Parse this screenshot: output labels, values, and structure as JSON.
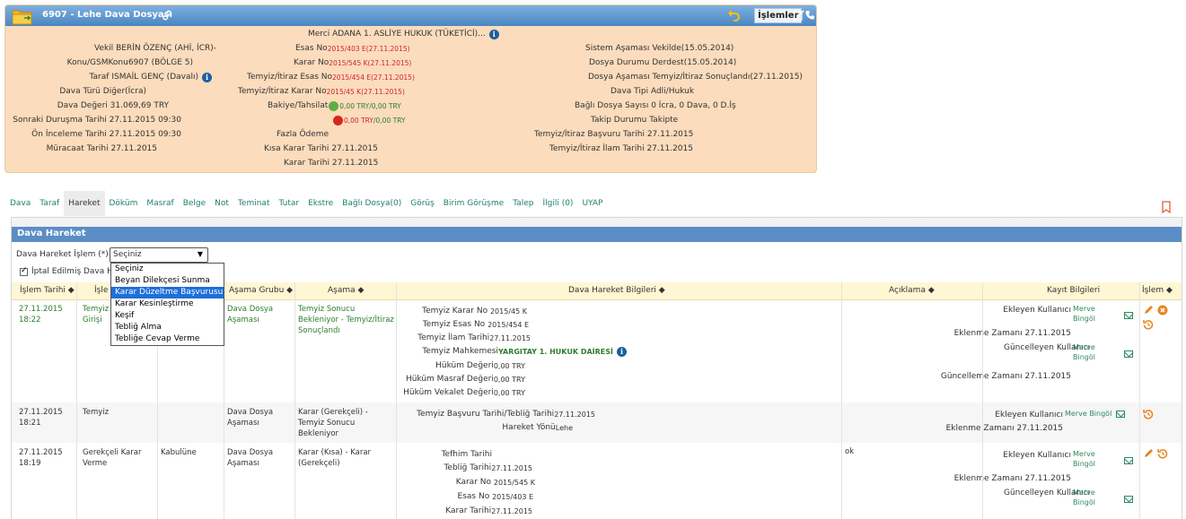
{
  "case": {
    "title": "6907 - Lehe Dava Dosyası",
    "islemler_label": "İşlemler",
    "col1": [
      {
        "label": "Vekil",
        "value": "BERİN ÖZENÇ (AHİ, İCR)-"
      },
      {
        "label": "Konu/GSM",
        "value": "Konu6907 (BÖLGE 5)"
      },
      {
        "label": "Taraf",
        "value": "ISMAİL GENÇ (Davalı)"
      },
      {
        "label": "Dava Türü",
        "value": "Diğer(İcra)"
      },
      {
        "label": "Dava Değeri",
        "value": "31.069,69 TRY"
      },
      {
        "label": "Sonraki Duruşma Tarihi",
        "value": "27.11.2015 09:30"
      },
      {
        "label": "Ön İnceleme Tarihi",
        "value": "27.11.2015 09:30"
      },
      {
        "label": "Müracaat Tarihi",
        "value": "27.11.2015"
      }
    ],
    "merci": {
      "label": "Merci",
      "value": "ADANA 1. ASLİYE HUKUK (TÜKETİCİ)..."
    },
    "col2": [
      {
        "label": "Esas No",
        "value": "2015/403 E(27.11.2015)"
      },
      {
        "label": "Karar No",
        "value": "2015/545 K(27.11.2015)"
      },
      {
        "label": "Temyiz/İtiraz Esas No",
        "value": "2015/454 E(27.11.2015)"
      },
      {
        "label": "Temyiz/İtiraz Karar No",
        "value": "2015/45 K(27.11.2015)"
      }
    ],
    "bakiye": {
      "label": "Bakiye/Tahsilat",
      "line1a": "0,00 TRY",
      "line1b": "0,00 TRY",
      "line2a": "0,00 TRY",
      "line2b": "0,00 TRY"
    },
    "col2b": [
      {
        "label": "Fazla Ödeme",
        "value": ""
      },
      {
        "label": "Kısa Karar Tarihi",
        "value": "27.11.2015"
      },
      {
        "label": "Karar Tarihi",
        "value": "27.11.2015"
      }
    ],
    "col3": [
      {
        "label": "Sistem Aşaması",
        "value": "Vekilde(15.05.2014)"
      },
      {
        "label": "Dosya Durumu",
        "value": "Derdest(15.05.2014)"
      },
      {
        "label": "Dosya Aşaması",
        "value": "Temyiz/İtiraz Sonuçlandı(27.11.2015)"
      },
      {
        "label": "Dava Tipi",
        "value": "Adli/Hukuk"
      },
      {
        "label": "Bağlı Dosya Sayısı",
        "value": "0 İcra, 0 Dava, 0 D.İş"
      },
      {
        "label": "Takip Durumu",
        "value": "Takipte"
      },
      {
        "label": "Temyiz/İtiraz Başvuru Tarihi",
        "value": "27.11.2015"
      },
      {
        "label": "Temyiz/İtiraz İlam Tarihi",
        "value": "27.11.2015"
      }
    ]
  },
  "tabs": [
    "Dava",
    "Taraf",
    "Hareket",
    "Döküm",
    "Masraf",
    "Belge",
    "Not",
    "Teminat",
    "Tutar",
    "Ekstre",
    "Bağlı Dosya(0)",
    "Görüş",
    "Birim Görüşme",
    "Talep",
    "İlgili (0)",
    "UYAP"
  ],
  "active_tab": "Hareket",
  "hareket": {
    "title": "Dava Hareket",
    "islem_label": "Dava Hareket İşlem (*)",
    "selected": "Seçiniz",
    "checkbox_label": "İptal Edilmiş Dava H",
    "options": [
      "Seçiniz",
      "Beyan Dilekçesi Sunma",
      "Karar Düzeltme Başvurusu",
      "Karar Kesinleştirme",
      "Keşif",
      "Tebliğ Alma",
      "Tebliğe Cevap Verme"
    ],
    "highlighted_option": "Karar Düzeltme Başvurusu"
  },
  "table": {
    "headers": [
      "İşlem Tarihi",
      "İşle",
      "Aşama Grubu",
      "Aşama",
      "Dava Hareket Bilgileri",
      "Açıklama",
      "Kayıt Bilgileri",
      "İşlem"
    ],
    "rows": [
      {
        "date": "27.11.2015",
        "time": "18:22",
        "islem": "Temyiz",
        "islem2": "Girişi",
        "sonuc": "",
        "asama_grubu": "Dava Dosya Aşaması",
        "asama": "Temyiz Sonucu Bekleniyor - Temyiz/İtiraz Sonuçlandı",
        "bilgi": [
          {
            "k": "Temyiz Karar No",
            "v": "2015/45 K"
          },
          {
            "k": "Temyiz Esas No",
            "v": "2015/454 E"
          },
          {
            "k": "Temyiz İlam Tarihi",
            "v": "27.11.2015"
          },
          {
            "k": "Temyiz Mahkemesi",
            "v": "YARGITAY 1. HUKUK DAİRESİ"
          },
          {
            "k": "Hüküm Değeri",
            "v": "0,00 TRY"
          },
          {
            "k": "Hüküm Masraf Değeri",
            "v": "0,00 TRY"
          },
          {
            "k": "Hüküm Vekalet Değeri",
            "v": "0,00 TRY"
          }
        ],
        "aciklama": ""
      },
      {
        "date": "27.11.2015",
        "time": "18:21",
        "islem": "Temyiz",
        "islem2": "",
        "sonuc": "",
        "asama_grubu": "Dava Dosya Aşaması",
        "asama": "Karar (Gerekçeli) - Temyiz Sonucu Bekleniyor",
        "bilgi": [
          {
            "k": "Temyiz Başvuru Tarihi/Tebliğ Tarihi",
            "v": "27.11.2015"
          },
          {
            "k": "Hareket Yönü",
            "v": "Lehe"
          }
        ],
        "aciklama": ""
      },
      {
        "date": "27.11.2015",
        "time": "18:19",
        "islem": "Gerekçeli Karar",
        "islem2": "Verme",
        "sonuc": "Kabulüne",
        "asama_grubu": "Dava Dosya Aşaması",
        "asama": "Karar (Kısa) - Karar (Gerekçeli)",
        "bilgi": [
          {
            "k": "Tefhim Tarihi",
            "v": ""
          },
          {
            "k": "Tebliğ Tarihi",
            "v": "27.11.2015"
          },
          {
            "k": "Karar No",
            "v": "2015/545 K"
          },
          {
            "k": "Esas No",
            "v": "2015/403 E"
          },
          {
            "k": "Karar Tarihi",
            "v": "27.11.2015"
          }
        ],
        "aciklama": "ok"
      }
    ],
    "kayit": {
      "ekleyen": "Ekleyen Kullanıcı",
      "eklenme": "Eklenme Zamanı",
      "guncelleyen": "Güncelleyen Kullanıcı",
      "guncelleme": "Güncelleme Zamanı",
      "user_a": "Merve",
      "user_b": "Bingöl",
      "user_full": "Merve Bingöl",
      "date": "27.11.2015"
    }
  }
}
